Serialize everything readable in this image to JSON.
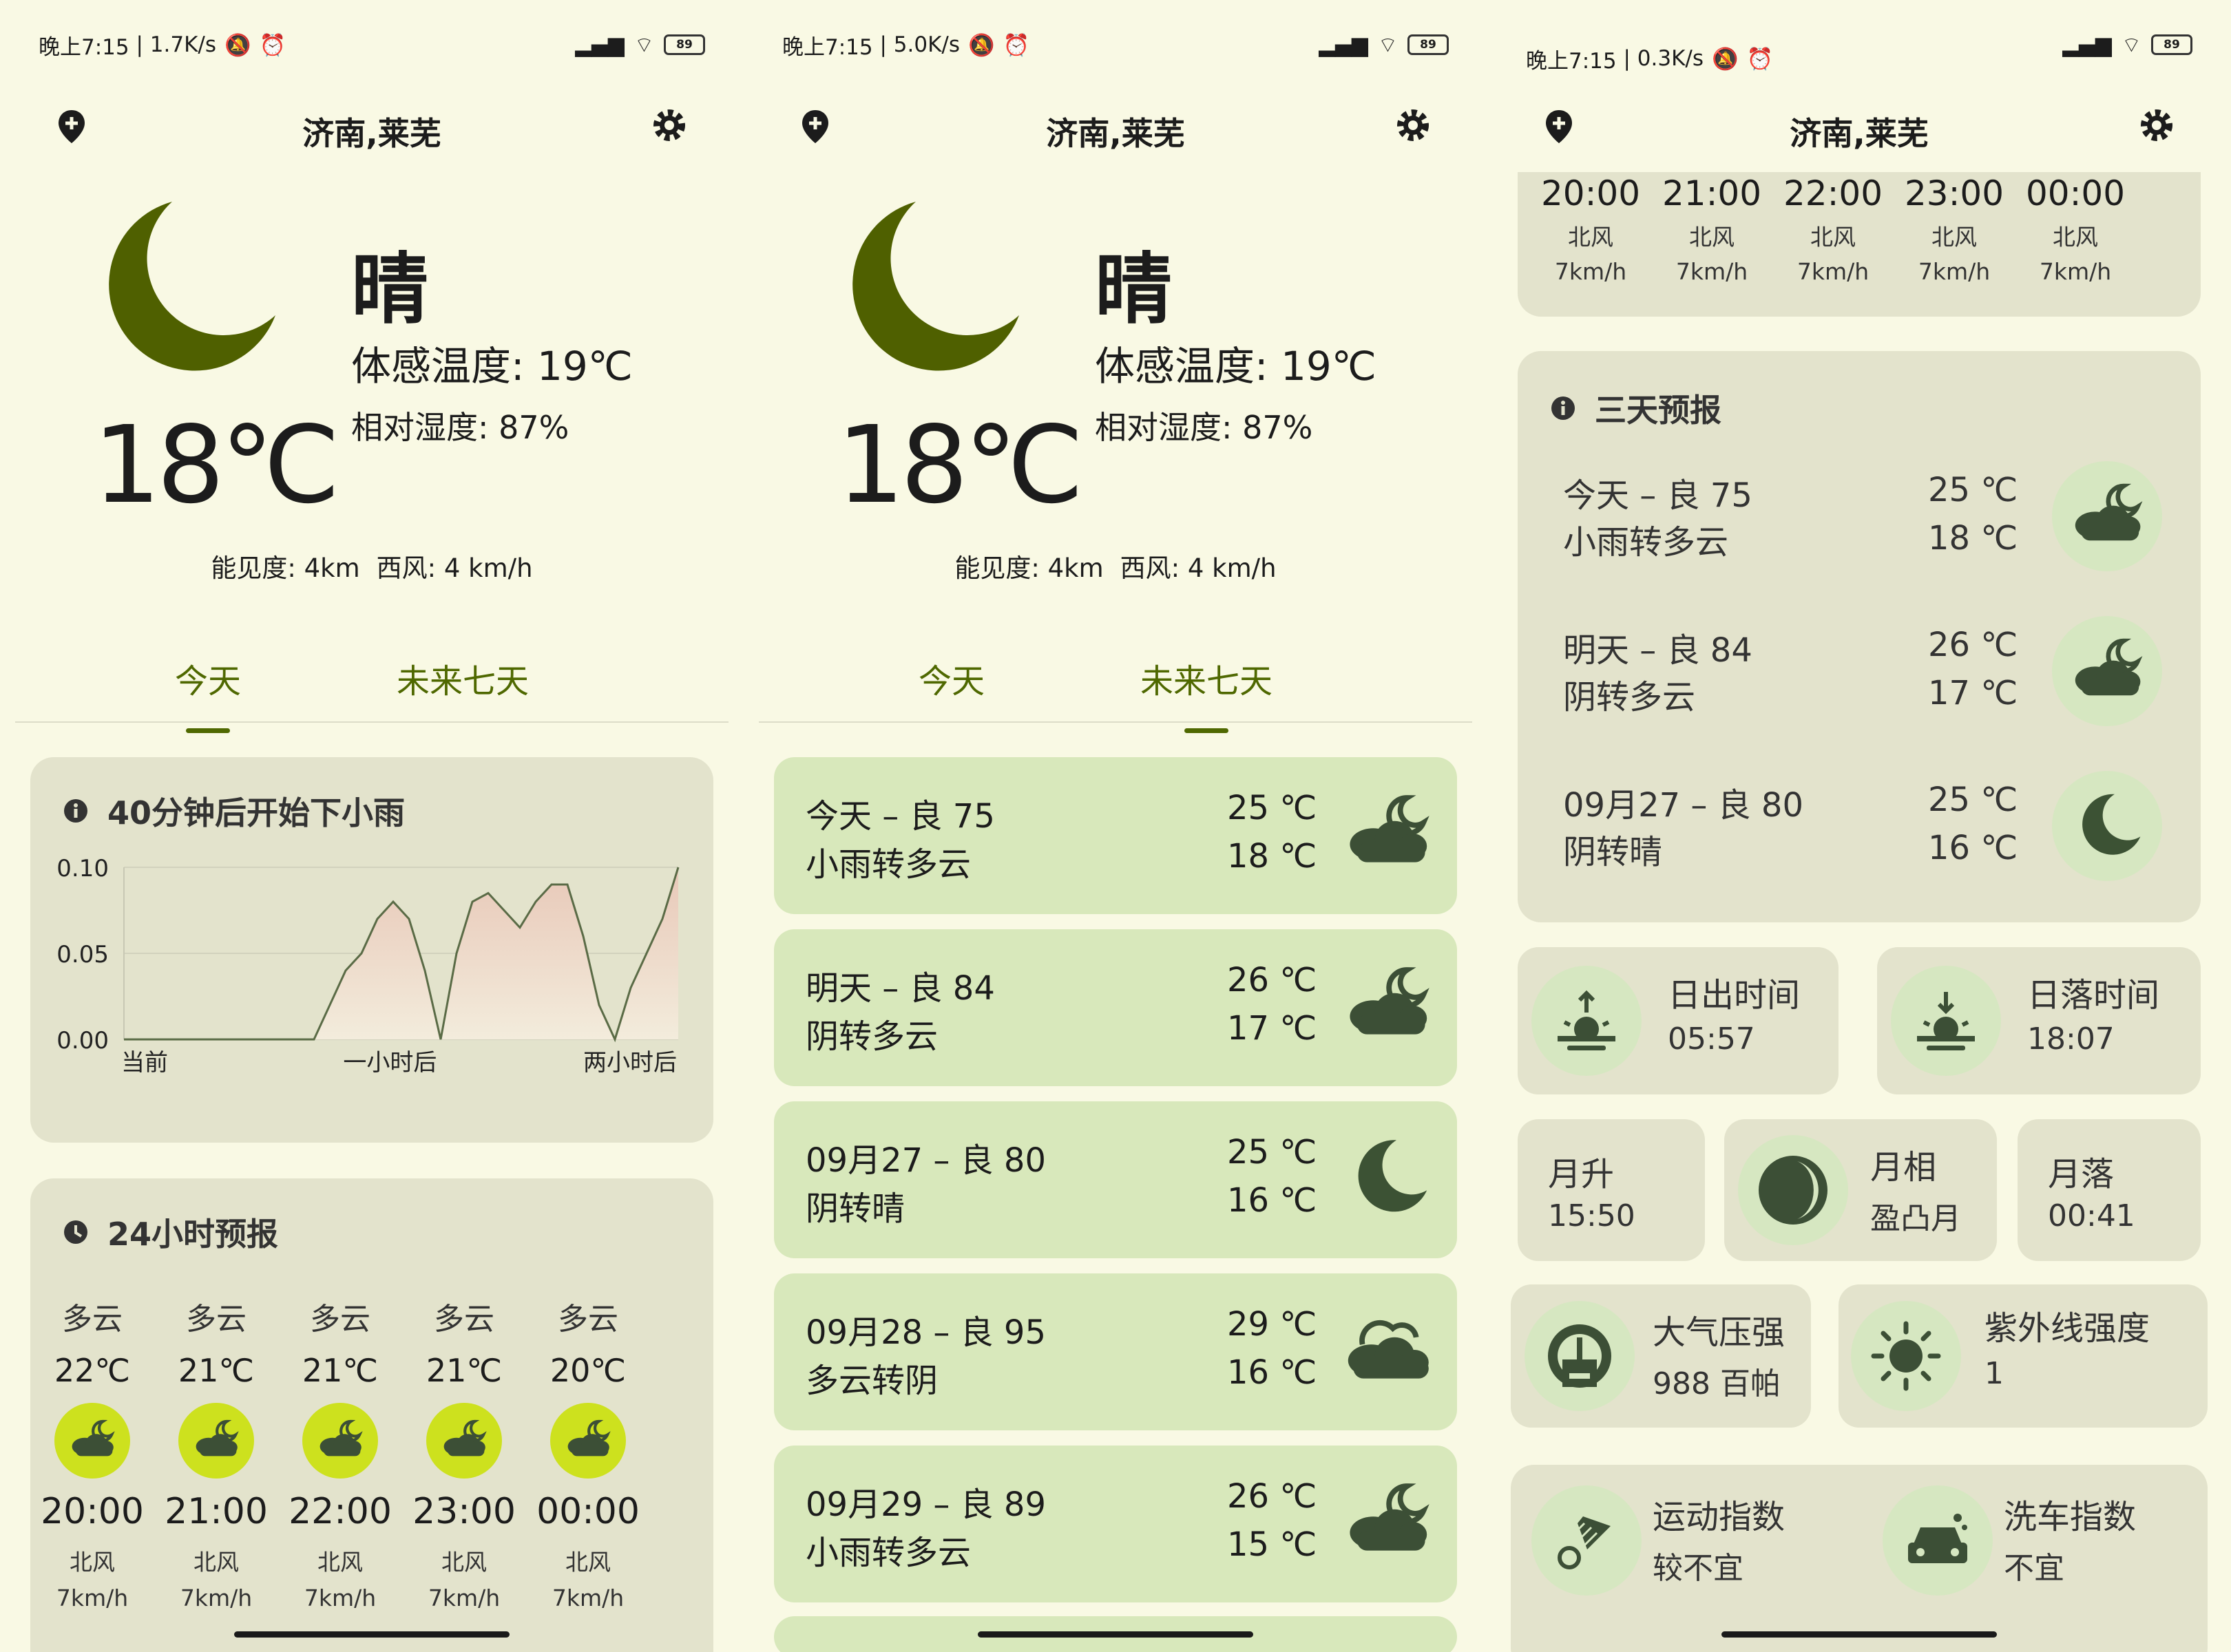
{
  "status": [
    {
      "time": "晚上7:15",
      "net": "1.7K/s"
    },
    {
      "time": "晚上7:15",
      "net": "5.0K/s"
    },
    {
      "time": "晚上7:15",
      "net": "0.3K/s"
    }
  ],
  "battery": "89",
  "city": "济南,莱芜",
  "current": {
    "condition": "晴",
    "feels": "体感温度: 19℃",
    "humidity": "相对湿度: 87%",
    "temp": "18℃",
    "visibility": "能见度: 4km",
    "wind": "西风: 4 km/h"
  },
  "tabs": {
    "today": "今天",
    "week": "未来七天"
  },
  "rain": {
    "title": "40分钟后开始下小雨",
    "y_ticks": [
      "0.10",
      "0.05",
      "0.00"
    ],
    "x_ticks": [
      "当前",
      "一小时后",
      "两小时后"
    ],
    "values": [
      0,
      0,
      0,
      0,
      0,
      0,
      0,
      0,
      0,
      0,
      0,
      0,
      0,
      0.02,
      0.04,
      0.05,
      0.07,
      0.08,
      0.07,
      0.04,
      0,
      0.05,
      0.08,
      0.085,
      0.075,
      0.065,
      0.08,
      0.09,
      0.09,
      0.06,
      0.02,
      0,
      0.03,
      0.05,
      0.07,
      0.1
    ]
  },
  "hourly": {
    "title": "24小时预报",
    "items": [
      {
        "desc": "多云",
        "temp": "22℃",
        "hour": "20:00",
        "wind": "北风",
        "speed": "7km/h"
      },
      {
        "desc": "多云",
        "temp": "21℃",
        "hour": "21:00",
        "wind": "北风",
        "speed": "7km/h"
      },
      {
        "desc": "多云",
        "temp": "21℃",
        "hour": "22:00",
        "wind": "北风",
        "speed": "7km/h"
      },
      {
        "desc": "多云",
        "temp": "21℃",
        "hour": "23:00",
        "wind": "北风",
        "speed": "7km/h"
      },
      {
        "desc": "多云",
        "temp": "20℃",
        "hour": "00:00",
        "wind": "北风",
        "speed": "7km/h"
      }
    ]
  },
  "days": [
    {
      "title": "今天 – 良 75",
      "desc": "小雨转多云",
      "hi": "25 ℃",
      "lo": "18 ℃",
      "icon": "cloudy-night-icon"
    },
    {
      "title": "明天 – 良 84",
      "desc": "阴转多云",
      "hi": "26 ℃",
      "lo": "17 ℃",
      "icon": "cloudy-night-icon"
    },
    {
      "title": "09月27 – 良 80",
      "desc": "阴转晴",
      "hi": "25 ℃",
      "lo": "16 ℃",
      "icon": "moon-icon"
    },
    {
      "title": "09月28 – 良 95",
      "desc": "多云转阴",
      "hi": "29 ℃",
      "lo": "16 ℃",
      "icon": "cloud-icon"
    },
    {
      "title": "09月29 – 良 89",
      "desc": "小雨转多云",
      "hi": "26 ℃",
      "lo": "15 ℃",
      "icon": "cloudy-night-icon"
    }
  ],
  "three_day_title": "三天预报",
  "sun": {
    "rise_label": "日出时间",
    "rise": "05:57",
    "set_label": "日落时间",
    "set": "18:07"
  },
  "moon": {
    "rise_label": "月升",
    "rise": "15:50",
    "phase_label": "月相",
    "phase": "盈凸月",
    "set_label": "月落",
    "set": "00:41"
  },
  "pressure": {
    "label": "大气压强",
    "value": "988 百帕"
  },
  "uv": {
    "label": "紫外线强度",
    "value": "1"
  },
  "sport": {
    "label": "运动指数",
    "value": "较不宜"
  },
  "carwash": {
    "label": "洗车指数",
    "value": "不宜"
  }
}
